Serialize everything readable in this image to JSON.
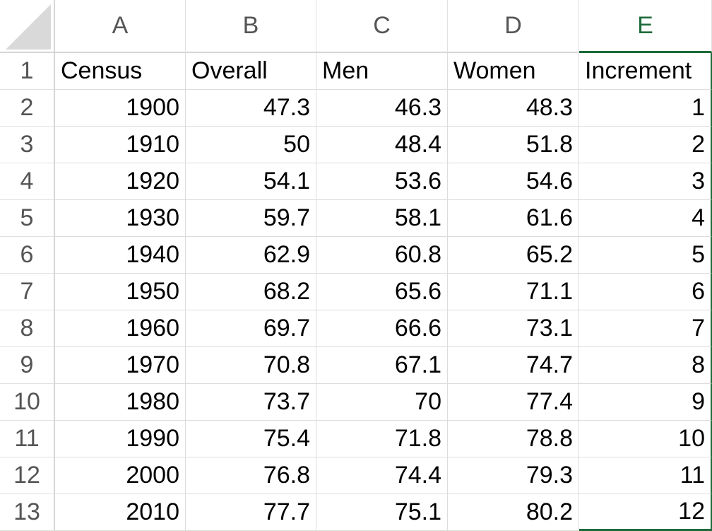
{
  "columns": [
    "A",
    "B",
    "C",
    "D",
    "E"
  ],
  "active_column": "E",
  "headers": [
    "Census",
    "Overall",
    "Men",
    "Women",
    "Increment"
  ],
  "rows": [
    [
      "1900",
      "47.3",
      "46.3",
      "48.3",
      "1"
    ],
    [
      "1910",
      "50",
      "48.4",
      "51.8",
      "2"
    ],
    [
      "1920",
      "54.1",
      "53.6",
      "54.6",
      "3"
    ],
    [
      "1930",
      "59.7",
      "58.1",
      "61.6",
      "4"
    ],
    [
      "1940",
      "62.9",
      "60.8",
      "65.2",
      "5"
    ],
    [
      "1950",
      "68.2",
      "65.6",
      "71.1",
      "6"
    ],
    [
      "1960",
      "69.7",
      "66.6",
      "73.1",
      "7"
    ],
    [
      "1970",
      "70.8",
      "67.1",
      "74.7",
      "8"
    ],
    [
      "1980",
      "73.7",
      "70",
      "77.4",
      "9"
    ],
    [
      "1990",
      "75.4",
      "71.8",
      "78.8",
      "10"
    ],
    [
      "2000",
      "76.8",
      "74.4",
      "79.3",
      "11"
    ],
    [
      "2010",
      "77.7",
      "75.1",
      "80.2",
      "12"
    ]
  ],
  "row_numbers": [
    "1",
    "2",
    "3",
    "4",
    "5",
    "6",
    "7",
    "8",
    "9",
    "10",
    "11",
    "12",
    "13"
  ],
  "colors": {
    "selection_accent": "#1f6b3a",
    "header_text": "#555555",
    "gridline": "#dcdcdc"
  }
}
